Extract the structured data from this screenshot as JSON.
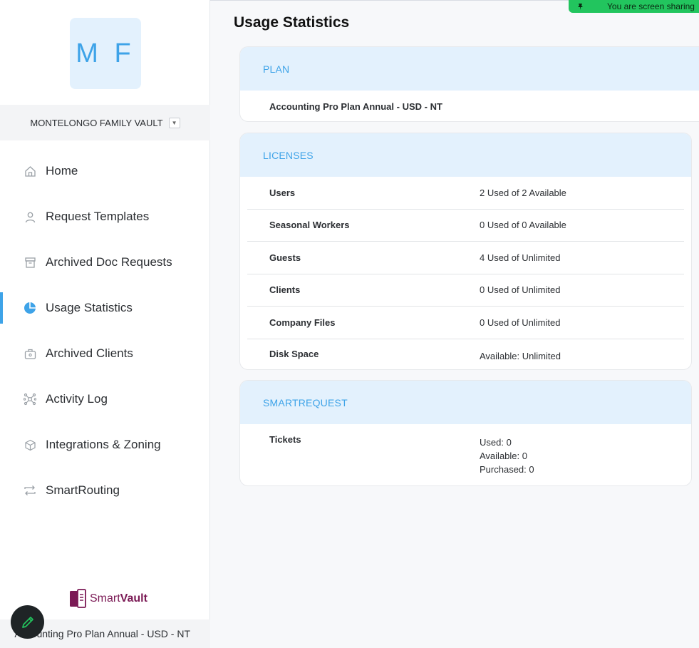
{
  "sidebar": {
    "avatar_initials": "M F",
    "vault_name": "MONTELONGO FAMILY VAULT",
    "nav_items": [
      {
        "label": "Home",
        "icon": "home-icon"
      },
      {
        "label": "Request Templates",
        "icon": "person-icon"
      },
      {
        "label": "Archived Doc Requests",
        "icon": "archive-box-icon"
      },
      {
        "label": "Usage Statistics",
        "icon": "pie-chart-icon",
        "active": true
      },
      {
        "label": "Archived Clients",
        "icon": "briefcase-icon"
      },
      {
        "label": "Activity Log",
        "icon": "network-icon"
      },
      {
        "label": "Integrations & Zoning",
        "icon": "cube-icon"
      },
      {
        "label": "SmartRouting",
        "icon": "repeat-icon"
      }
    ],
    "logo_text_light": "Smart",
    "logo_text_bold": "Vault",
    "footer_plan": "Accounting Pro Plan Annual - USD - NT"
  },
  "banner": {
    "text": "You are screen sharing"
  },
  "main": {
    "title": "Usage Statistics",
    "plan": {
      "header": "PLAN",
      "name": "Accounting Pro Plan Annual - USD - NT"
    },
    "licenses": {
      "header": "LICENSES",
      "rows": [
        {
          "label": "Users",
          "value": "2 Used of 2 Available"
        },
        {
          "label": "Seasonal Workers",
          "value": "0 Used of 0 Available"
        },
        {
          "label": "Guests",
          "value": "4 Used of Unlimited"
        },
        {
          "label": "Clients",
          "value": "0 Used of Unlimited"
        },
        {
          "label": "Company Files",
          "value": "0 Used of Unlimited"
        },
        {
          "label": "Disk Space",
          "value": "Available: Unlimited"
        }
      ]
    },
    "smartrequest": {
      "header": "SMARTREQUEST",
      "label": "Tickets",
      "used": "Used: 0",
      "available": "Available: 0",
      "purchased": "Purchased: 0"
    }
  },
  "colors": {
    "accent": "#3ea3e8",
    "header_bg": "#e3f1fd",
    "brand": "#7b1a55",
    "banner": "#22c55e"
  }
}
